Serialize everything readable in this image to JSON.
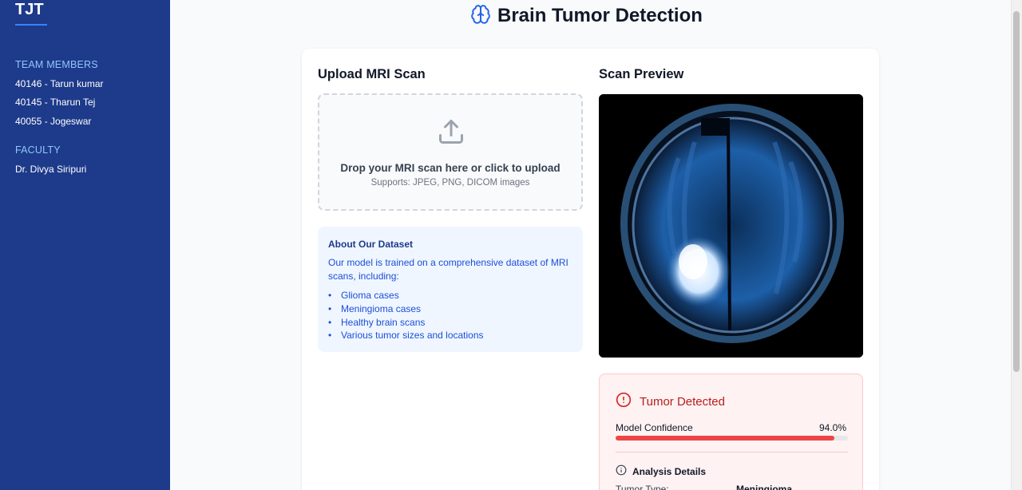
{
  "sidebar": {
    "brand": "TJT",
    "team_title": "TEAM MEMBERS",
    "members": [
      "40146 - Tarun kumar",
      "40145 - Tharun Tej",
      "40055 - Jogeswar"
    ],
    "faculty_title": "FACULTY",
    "faculty": [
      "Dr. Divya Siripuri"
    ]
  },
  "header": {
    "title": "Brain Tumor Detection",
    "icon": "brain-icon"
  },
  "upload": {
    "heading": "Upload MRI Scan",
    "drop_text": "Drop your MRI scan here or click to upload",
    "drop_sub": "Supports: JPEG, PNG, DICOM images",
    "icon": "upload-icon"
  },
  "dataset": {
    "title": "About Our Dataset",
    "description": "Our model is trained on a comprehensive dataset of MRI scans, including:",
    "items": [
      "Glioma cases",
      "Meningioma cases",
      "Healthy brain scans",
      "Various tumor sizes and locations"
    ]
  },
  "preview": {
    "heading": "Scan Preview"
  },
  "result": {
    "title": "Tumor Detected",
    "confidence_label": "Model Confidence",
    "confidence_text": "94.0%",
    "confidence_fraction": 0.94,
    "analysis_label": "Analysis Details",
    "type_label": "Tumor Type:",
    "type_value": "Meningioma"
  },
  "colors": {
    "sidebar": "#1e3a8a",
    "accent": "#3b82f6",
    "danger": "#ef4444"
  }
}
